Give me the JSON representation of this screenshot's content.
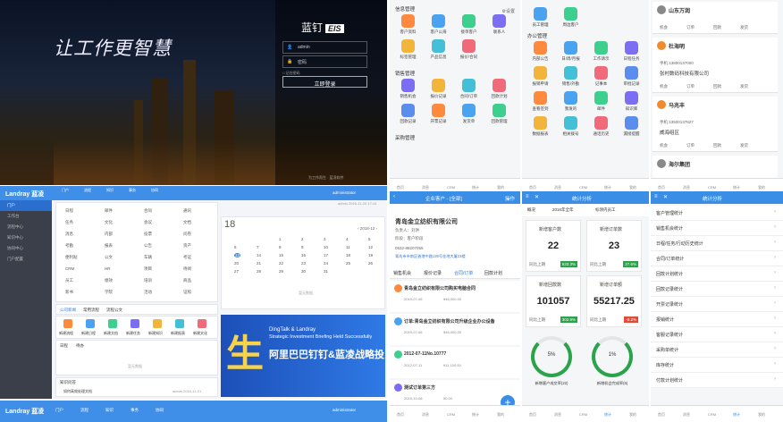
{
  "login": {
    "slogan": "让工作更智慧",
    "brand": "蓝钉",
    "brand_tag": "EIS",
    "user": "admin",
    "password": "密码",
    "login_btn": "立即登录",
    "remember": "□ 记住密码",
    "footer": "为工作而生 · 蓝凌软件"
  },
  "portal": {
    "logo": "Landray 蓝凌",
    "nav": [
      "门户",
      "流程",
      "知识",
      "事务",
      "协同"
    ],
    "user": "administrator",
    "sidebar": [
      "门户",
      "工作台",
      "流程中心",
      "知识中心",
      "协同中心",
      "门户配置"
    ],
    "modules": [
      [
        "日程",
        "邮件",
        "合同",
        "通讯"
      ],
      [
        "任务",
        "文化",
        "会议",
        "文档"
      ],
      [
        "消息",
        "内部",
        "投票",
        "问卷"
      ],
      [
        "考勤",
        "报表",
        "公告",
        "资产"
      ],
      [
        "便利贴",
        "公文",
        "车辆",
        "考证"
      ],
      [
        "CRM",
        "HR",
        "项目",
        "待阅"
      ],
      [
        "员工",
        "绩效",
        "培训",
        "商品"
      ],
      [
        "新书",
        "学院",
        "活动",
        "证照"
      ]
    ],
    "doc_header": "admin 2016-11-20 17:14",
    "cal_day": "18",
    "cal_month": "‹ 2018-12 ›",
    "cal_today": "13",
    "tabs": [
      "公司新闻",
      "常用流程",
      "流程公文"
    ],
    "tiles": [
      "新建流程",
      "新建日程",
      "新建文档",
      "新建任务",
      "新建知识",
      "新建报表",
      "新建文化"
    ],
    "tasks_tab": [
      "日程",
      "待办"
    ],
    "banner_line1": "DingTalk & Landray",
    "banner_line2": "Strategic Investment Briefing Held Successfully",
    "banner_cn": "阿里巴巴钉钉&蓝凌战略投",
    "kq_title": "知识问答",
    "kq_item": "如何高效处理文档",
    "kq_meta": "admin 2016-11-21",
    "empty": "暂无数据"
  },
  "app_grid": {
    "col1": {
      "settings": "⚙设置",
      "sections": [
        {
          "title": "信息管理",
          "items": [
            "客户资料",
            "客户公海",
            "接单客户",
            "联系人",
            "标签管理",
            "产品信息",
            "报价/合同"
          ]
        },
        {
          "title": "销售管理",
          "items": [
            "销售机会",
            "报价记录",
            "合同/订单",
            "回款计划",
            "回款记录",
            "开票记录",
            "发货单",
            "回款管理"
          ]
        },
        {
          "title": "采购管理",
          "items": []
        }
      ]
    },
    "col2": {
      "top": [
        "员工管理",
        "周边客户"
      ],
      "sections": [
        {
          "title": "办公管理",
          "items": [
            "内部公告",
            "日/周/月报",
            "工作请示",
            "日程任务",
            "报销申请",
            "销售/外勤",
            "记事本",
            "审批记录",
            "查看签到",
            "我发的",
            "邮件",
            "知识库",
            "数据报表",
            "相关拨号",
            "通话历史",
            "漏接提醒"
          ]
        }
      ]
    }
  },
  "contacts": [
    {
      "name": "山东万润",
      "tag": "",
      "rows": [
        "机会",
        "订单",
        "回款",
        "发货"
      ]
    },
    {
      "name": "杜海明",
      "tag": "联",
      "sub": "张村数码科技有限公司",
      "phone": "手机:13800137000",
      "rows": [
        "机会",
        "订单",
        "回款",
        "发货"
      ]
    },
    {
      "name": "马兆丰",
      "tag": "联",
      "sub": "威海组区",
      "phone": "手机:13500137827",
      "rows": [
        "机会",
        "订单",
        "回款",
        "发货"
      ]
    },
    {
      "name": "海尔集团",
      "tag": "",
      "rows": [
        "机会",
        "订单",
        "回款",
        "发货"
      ]
    }
  ],
  "company": {
    "header": "企业客户 - [全部]",
    "action": "操作",
    "name": "青岛金立纺织有限公司",
    "owner": "负责人：刘洪",
    "stage": "阶段：客户阶段",
    "phone": "0532-88207055",
    "address": "青岛市市南区香港中路126号金地大厦23楼",
    "tabs": [
      "销售机会",
      "报价记录",
      "合同/订单",
      "回款计划"
    ],
    "records": [
      {
        "title": "青岛金立纺织有限公司购买电脑合同",
        "date": "2019-07-06",
        "amount": "¥46,000.00"
      },
      {
        "title": "订单:青岛金立纺织有限公司升级企业办公设备",
        "date": "2019-07-06",
        "amount": "¥46,000.00"
      },
      {
        "title": "2012-07-11No.10777",
        "date": "2012-07-11",
        "amount": "¥11,100.00"
      },
      {
        "title": "测试订单第三方",
        "date": "2019-10-08",
        "amount": "¥0.00"
      }
    ]
  },
  "stats": {
    "title": "统计分析",
    "filters": [
      "概况",
      "2016年全年",
      "标领内员工"
    ],
    "cards": [
      {
        "label": "新增客户数",
        "value": "22",
        "compare": "同比上期",
        "pct": "633.3%",
        "color": "#2aa34a"
      },
      {
        "label": "新增订单数",
        "value": "23",
        "compare": "同比上期",
        "pct": "27.6%",
        "color": "#2aa34a"
      },
      {
        "label": "新增回款数",
        "value": "101057",
        "compare": "同比上期",
        "pct": "302.9%",
        "color": "#2aa34a"
      },
      {
        "label": "新增订单额",
        "value": "55217.25",
        "compare": "同比上期",
        "pct": "-0.2%",
        "color": "#e04b3a"
      }
    ],
    "gauges": [
      {
        "value": "5%",
        "label": "新增客户成交率(22)"
      },
      {
        "value": "1%",
        "label": "新增机会完成率(6)"
      }
    ]
  },
  "stat_menu": {
    "title": "统计分析",
    "items": [
      "客户管理统计",
      "销售机会统计",
      "日程/任务/行动历史统计",
      "合同/订单统计",
      "回款计划统计",
      "回款记录统计",
      "开票记录统计",
      "报销统计",
      "客服记录统计",
      "采购单统计",
      "库存统计",
      "付款计划统计"
    ]
  },
  "tabbar": [
    "首页",
    "消息",
    "CRM",
    "统计",
    "我的"
  ],
  "footer_portal": {
    "logo": "Landray 蓝凌",
    "nav": [
      "门户",
      "流程",
      "知识",
      "事务",
      "协同"
    ],
    "user": "administrator"
  },
  "colors": {
    "primary": "#3a8ee6",
    "sidebar": "#3a3f4a",
    "green": "#2aa34a",
    "red": "#e04b3a"
  }
}
